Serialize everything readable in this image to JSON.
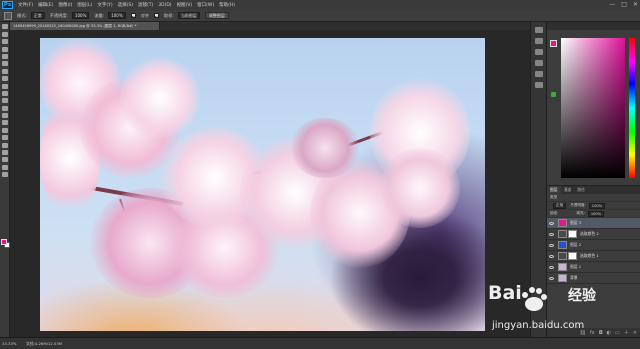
{
  "app": {
    "logo": "Ps",
    "menu": [
      "文件(F)",
      "编辑(E)",
      "图像(I)",
      "图层(L)",
      "文字(Y)",
      "选择(S)",
      "滤镜(T)",
      "3D(D)",
      "视图(V)",
      "窗口(W)",
      "帮助(H)"
    ],
    "window_controls": [
      "—",
      "□",
      "✕"
    ]
  },
  "options_bar": {
    "mode_label": "模式:",
    "mode_value": "正常",
    "opacity_label": "不透明度:",
    "opacity_value": "100%",
    "flow_label": "流量:",
    "flow_value": "100%",
    "check1_label": "对齐",
    "check2_label": "取样:",
    "sample_value": "当前图层",
    "button_label": "调整图层"
  },
  "document": {
    "tab_title": "1469456999_20160525_160456000.jpg @ 33.3% (图层 1, RGB/8#) *",
    "zoom": "33.33%",
    "doc_info": "文档:4.26M/12.03M"
  },
  "colors": {
    "foreground": "#e4188a",
    "background": "#ffffff",
    "accent_selected_layer": "#525a66"
  },
  "layers_panel": {
    "tabs": [
      "图层",
      "通道",
      "路径"
    ],
    "kind_label": "类型",
    "blend_value": "正常",
    "opacity_label": "不透明度:",
    "opacity_value": "100%",
    "lock_label": "锁定:",
    "fill_label": "填充:",
    "fill_value": "100%",
    "layers": [
      {
        "name": "图层 3",
        "thumb_color": "#e4188a",
        "has_mask": false,
        "selected": true
      },
      {
        "name": "选取颜色 2",
        "thumb_color": "#4a4a4a",
        "has_mask": true,
        "selected": false
      },
      {
        "name": "图层 2",
        "thumb_color": "#2255cc",
        "has_mask": false,
        "selected": false
      },
      {
        "name": "选取颜色 1",
        "thumb_color": "#4a4a4a",
        "has_mask": true,
        "selected": false
      },
      {
        "name": "图层 1",
        "thumb_color": "#c9b4d2",
        "has_mask": false,
        "selected": false
      },
      {
        "name": "背景",
        "thumb_color": "#c9b4d2",
        "has_mask": false,
        "selected": false
      }
    ]
  },
  "watermark": {
    "brand": "Bai",
    "brand_suffix": "经验",
    "url": "jingyan.baidu.com"
  }
}
